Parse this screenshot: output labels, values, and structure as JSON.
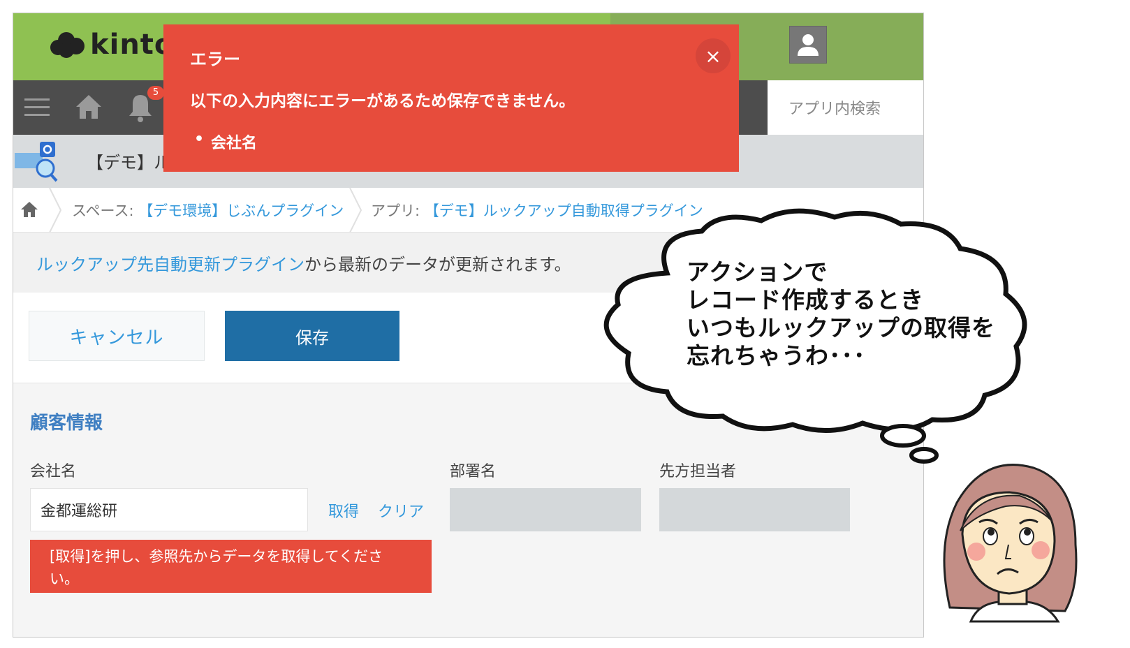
{
  "header": {
    "logo_text": "kinton",
    "logo_icon": "cloud-logo-icon",
    "user_icon": "user-avatar-icon"
  },
  "navbar": {
    "menu_icon": "hamburger-menu-icon",
    "home_icon": "home-icon",
    "bell_icon": "bell-icon",
    "notification_count": "5",
    "search_placeholder": "アプリ内検索"
  },
  "app": {
    "title": "【デモ】ル"
  },
  "breadcrumb": {
    "space_label": "スペース:",
    "space_name": "【デモ環境】じぶんプラグイン",
    "app_label": "アプリ:",
    "app_name": "【デモ】ルックアップ自動取得プラグイン"
  },
  "notice": {
    "link_text": "ルックアップ先自動更新プラグイン",
    "rest_text": "から最新のデータが更新されます。"
  },
  "toolbar": {
    "cancel_label": "キャンセル",
    "save_label": "保存"
  },
  "form": {
    "section_title": "顧客情報",
    "company_label": "会社名",
    "company_value": "金都運総研",
    "lookup_get": "取得",
    "lookup_clear": "クリア",
    "dept_label": "部署名",
    "contact_label": "先方担当者",
    "field_error": "[取得]を押し、参照先からデータを取得してください。"
  },
  "error_popup": {
    "title": "エラー",
    "message": "以下の入力内容にエラーがあるため保存できません。",
    "items": [
      "会社名"
    ],
    "close_label": "×"
  },
  "bubble": {
    "lines": [
      "アクションで",
      "レコード作成するとき",
      "いつもルックアップの取得を",
      "忘れちゃうわ･･･"
    ]
  },
  "colors": {
    "header_green": "#8fc152",
    "nav_gray": "#4d4d4d",
    "error_red": "#e74c3c",
    "save_blue": "#1f6ea5",
    "link_blue": "#3498db"
  }
}
